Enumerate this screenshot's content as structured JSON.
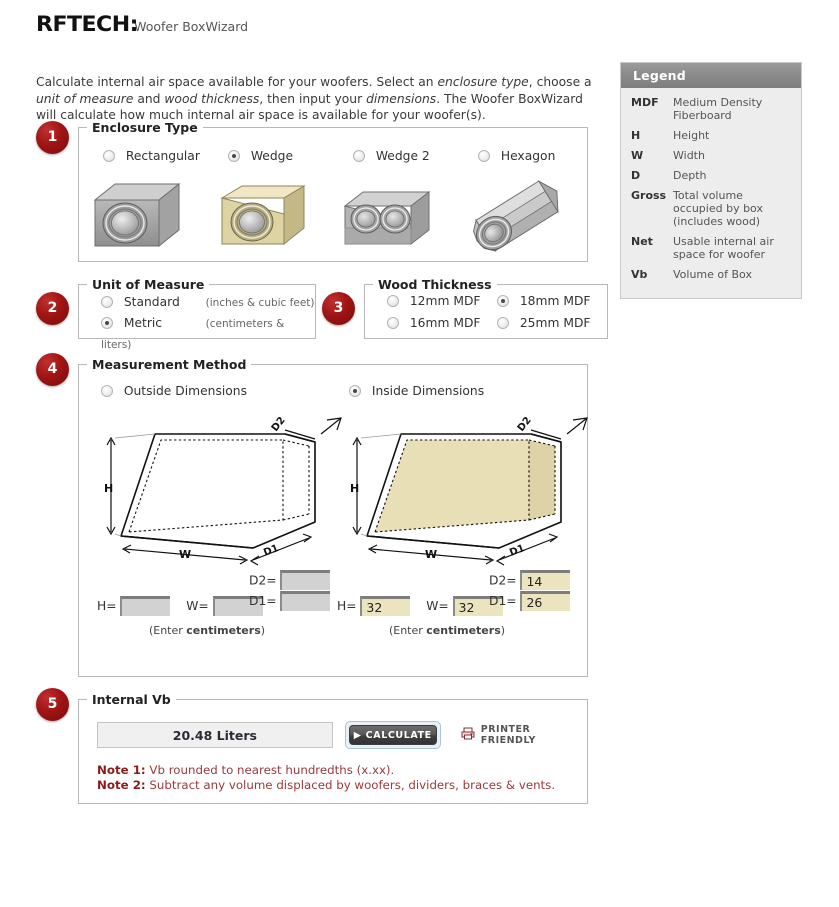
{
  "header": {
    "logo": "RFTECH:",
    "app_title": "Woofer BoxWizard"
  },
  "intro": {
    "part1": "Calculate internal air space available for your woofers. Select an ",
    "em1": "enclosure type",
    "part2": ", choose a ",
    "em2": "unit of measure",
    "part3": " and ",
    "em3": "wood thickness",
    "part4": ", then input your ",
    "em4": "dimensions",
    "part5": ". The Woofer BoxWizard will calculate how much internal air space is available for your woofer(s)."
  },
  "legend": {
    "title": "Legend",
    "rows": [
      {
        "term": "MDF",
        "def": "Medium Density Fiberboard"
      },
      {
        "term": "H",
        "def": "Height"
      },
      {
        "term": "W",
        "def": "Width"
      },
      {
        "term": "D",
        "def": "Depth"
      },
      {
        "term": "Gross",
        "def": "Total volume occupied by box (includes wood)"
      },
      {
        "term": "Net",
        "def": "Usable internal air space for woofer"
      },
      {
        "term": "Vb",
        "def": "Volume of Box"
      }
    ]
  },
  "steps": {
    "s1": "1",
    "s2": "2",
    "s3": "3",
    "s4": "4",
    "s5": "5"
  },
  "enclosure": {
    "legend": "Enclosure Type",
    "options": [
      {
        "label": "Rectangular",
        "selected": false,
        "icon": "rectangular-box-icon"
      },
      {
        "label": "Wedge",
        "selected": true,
        "icon": "wedge-box-icon"
      },
      {
        "label": "Wedge 2",
        "selected": false,
        "icon": "wedge2-box-icon"
      },
      {
        "label": "Hexagon",
        "selected": false,
        "icon": "hexagon-box-icon"
      }
    ]
  },
  "unit": {
    "legend": "Unit of Measure",
    "options": [
      {
        "label": "Standard",
        "hint": "(inches & cubic feet)",
        "selected": false
      },
      {
        "label": "Metric",
        "hint": "(centimeters & liters)",
        "selected": true
      }
    ]
  },
  "wood": {
    "legend": "Wood Thickness",
    "options": [
      {
        "label": "12mm MDF",
        "selected": false
      },
      {
        "label": "18mm MDF",
        "selected": true
      },
      {
        "label": "16mm MDF",
        "selected": false
      },
      {
        "label": "25mm MDF",
        "selected": false
      }
    ]
  },
  "measure": {
    "legend": "Measurement Method",
    "outside_label": "Outside Dimensions",
    "outside_selected": false,
    "inside_label": "Inside Dimensions",
    "inside_selected": true,
    "diagram_labels": {
      "h": "H",
      "w": "W",
      "d1": "D1",
      "d2": "D2"
    },
    "outside_fields": {
      "h_label": "H=",
      "h_value": "",
      "w_label": "W=",
      "w_value": "",
      "d1_label": "D1=",
      "d1_value": "",
      "d2_label": "D2=",
      "d2_value": "",
      "note_prefix": "(Enter ",
      "note_unit": "centimeters",
      "note_suffix": ")"
    },
    "inside_fields": {
      "h_label": "H=",
      "h_value": "32",
      "w_label": "W=",
      "w_value": "32",
      "d1_label": "D1=",
      "d1_value": "26",
      "d2_label": "D2=",
      "d2_value": "14",
      "note_prefix": "(Enter ",
      "note_unit": "centimeters",
      "note_suffix": ")"
    }
  },
  "vb": {
    "legend": "Internal Vb",
    "result": "20.48 Liters",
    "calculate_label": "CALCULATE",
    "printer_label": "PRINTER FRIENDLY",
    "note1_label": "Note 1:",
    "note1_text": " Vb rounded to nearest hundredths (x.xx).",
    "note2_label": "Note 2:",
    "note2_text": " Subtract any volume displaced by woofers, dividers, braces & vents."
  },
  "colors": {
    "accent_red": "#a01414",
    "selected_fill": "#ece3bf",
    "legend_header": "#8a8a8a",
    "note_red": "#9b3a3a"
  }
}
